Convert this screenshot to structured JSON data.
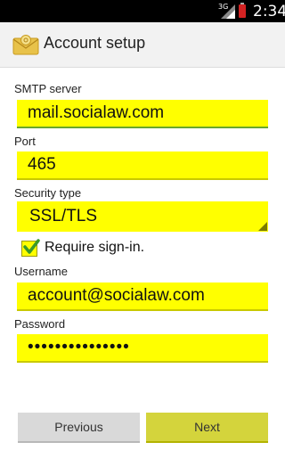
{
  "status_bar": {
    "network": "3G",
    "time": "2:34"
  },
  "action_bar": {
    "title": "Account setup",
    "icon": "email-app-icon"
  },
  "form": {
    "smtp_server": {
      "label": "SMTP server",
      "value": "mail.socialaw.com"
    },
    "port": {
      "label": "Port",
      "value": "465"
    },
    "security_type": {
      "label": "Security type",
      "value": "SSL/TLS"
    },
    "require_signin": {
      "label": "Require sign-in.",
      "checked": true
    },
    "username": {
      "label": "Username",
      "value": "account@socialaw.com"
    },
    "password": {
      "label": "Password",
      "value": "•••••••••••••••"
    }
  },
  "buttons": {
    "previous": "Previous",
    "next": "Next"
  },
  "colors": {
    "field_highlight": "#ffff00",
    "next_button": "#d4d43c",
    "check": "#3a9a2a"
  }
}
